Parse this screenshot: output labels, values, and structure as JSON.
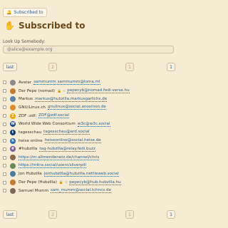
{
  "top": {
    "button_label": "Subscribed to"
  },
  "header": {
    "title": "Subscribed to"
  },
  "lookup": {
    "label": "Look Up Somebody:",
    "placeholder": "@alice@example.org"
  },
  "pager": {
    "last": "last",
    "prev": "2",
    "mid": "1",
    "first": "1"
  },
  "rows": [
    {
      "name": "Avatar",
      "handle": "sammumm sammumm@loma.ml",
      "color": "#8a8a8a",
      "glyph": ""
    },
    {
      "name": "Der Pepe (nomad)",
      "flags": "🔒 ☆",
      "handle": "pepecyb@nomad.fedi-verse.hu",
      "color": "#c47a2c",
      "glyph": ""
    },
    {
      "name": "Markus",
      "handle": "markus@hubzilla.markusgarlichs.de",
      "color": "#5a7fa8",
      "glyph": ""
    },
    {
      "name": "GNU/Linux.ch",
      "handle": "gnulinux@social.anoxinon.de",
      "color": "#e08a2a",
      "glyph": ""
    },
    {
      "name": "ZDF :zdf:",
      "handle": "ZDF@zdf.social",
      "color": "#f0a000",
      "glyph": "Z"
    },
    {
      "name": "World Wide Web Consortium",
      "handle": "w3c@w3c.social",
      "color": "#1f4e8c",
      "glyph": "W"
    },
    {
      "name": "tagesschau",
      "handle": "tagesschau@ard.social",
      "color": "#123b6e",
      "glyph": "t"
    },
    {
      "name": "heise online",
      "handle": "heiseonline@social.heise.de",
      "color": "#2b6cb0",
      "glyph": "h"
    },
    {
      "name": "#hubzilla",
      "handle": "tag-hubzilla@relay.fedi.buzz",
      "color": "#7a5c9a",
      "glyph": "#"
    },
    {
      "name": "",
      "handle": "https://m.allmendenetz.de/channel/chris",
      "color": "#8a6a4a",
      "glyph": ""
    },
    {
      "name": "",
      "handle": "https://mitra.social/users/silverpill",
      "color": "#6a8a5a",
      "glyph": ""
    },
    {
      "name": "Jon Hubzilla",
      "handle": "jonhubzilla@hubzilla.nettleweb.social",
      "color": "#4a7a9a",
      "glyph": ""
    },
    {
      "name": "Der Pepe (Hubzilla)",
      "flags": "🔒 ☆",
      "handle": "pepecyb@hub.hubzilla.hu",
      "color": "#c47a2c",
      "glyph": ""
    },
    {
      "name": "Samuel Mumm",
      "handle": "sam_mumm@social.tchncs.de",
      "color": "#7a6a5a",
      "glyph": ""
    }
  ]
}
